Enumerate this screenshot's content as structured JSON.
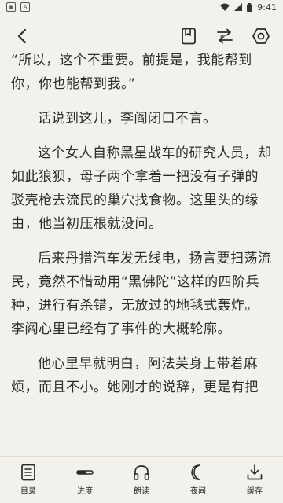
{
  "status": {
    "time": "9:41"
  },
  "toolbar": {
    "back_icon": "back-arrow-icon",
    "bookmark_icon": "bookmark-icon",
    "sync_icon": "swap-icon",
    "settings_icon": "settings-icon"
  },
  "content": {
    "paragraphs": [
      "“所以，这个不重要。前提是，我能帮到你，你也能帮到我。”",
      "话说到这儿，李阎闭口不言。",
      "这个女人自称黑星战车的研究人员，却如此狼狈，母子两个拿着一把没有子弹的驳壳枪去流民的巢穴找食物。这里头的缘由，他当初压根就没问。",
      "后来丹措汽车发无线电，扬言要扫荡流民，竟然不惜动用“黑佛陀”这样的四阶兵种，进行有杀错，无放过的地毯式轰炸。李阎心里已经有了事件的大概轮廓。",
      "他心里早就明白，阿法芙身上带着麻烦，而且不小。她刚才的说辞，更是有把"
    ]
  },
  "bottom_nav": [
    {
      "label": "目录",
      "icon": "catalog-icon"
    },
    {
      "label": "进度",
      "icon": "progress-icon"
    },
    {
      "label": "朗读",
      "icon": "headphones-icon"
    },
    {
      "label": "夜间",
      "icon": "moon-icon"
    },
    {
      "label": "缓存",
      "icon": "download-icon"
    }
  ]
}
